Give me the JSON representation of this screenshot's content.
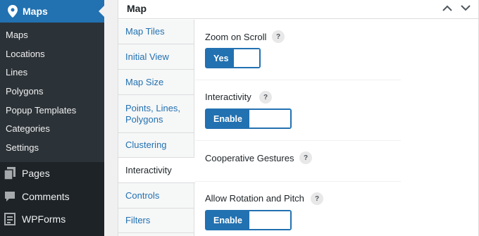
{
  "sidebar": {
    "active_menu": {
      "label": "Maps",
      "icon": "map-marker-icon"
    },
    "submenu": [
      "Maps",
      "Locations",
      "Lines",
      "Polygons",
      "Popup Templates",
      "Categories",
      "Settings"
    ],
    "top_items": [
      {
        "label": "Pages",
        "icon": "pages-icon"
      },
      {
        "label": "Comments",
        "icon": "comments-icon"
      },
      {
        "label": "WPForms",
        "icon": "wpforms-icon"
      }
    ]
  },
  "postbox": {
    "title": "Map",
    "controls": [
      "chevron-up-icon",
      "chevron-down-icon"
    ]
  },
  "tabs": [
    {
      "label": "Map Tiles",
      "active": false
    },
    {
      "label": "Initial View",
      "active": false
    },
    {
      "label": "Map Size",
      "active": false
    },
    {
      "label": "Points, Lines, Polygons",
      "active": false
    },
    {
      "label": "Clustering",
      "active": false
    },
    {
      "label": "Interactivity",
      "active": true
    },
    {
      "label": "Controls",
      "active": false
    },
    {
      "label": "Filters",
      "active": false
    }
  ],
  "settings": [
    {
      "label": "Zoom on Scroll",
      "help": "?",
      "toggle_label": "Yes",
      "checked": true
    },
    {
      "label": "Interactivity",
      "help": "?",
      "toggle_label": "Enable",
      "checked": true
    },
    {
      "label": "Cooperative Gestures",
      "help": "?"
    },
    {
      "label": "Allow Rotation and Pitch",
      "help": "?",
      "toggle_label": "Enable",
      "checked": true
    }
  ],
  "colors": {
    "admin_bg": "#1d2327",
    "submenu_bg": "#2c3338",
    "accent": "#2271b1"
  }
}
